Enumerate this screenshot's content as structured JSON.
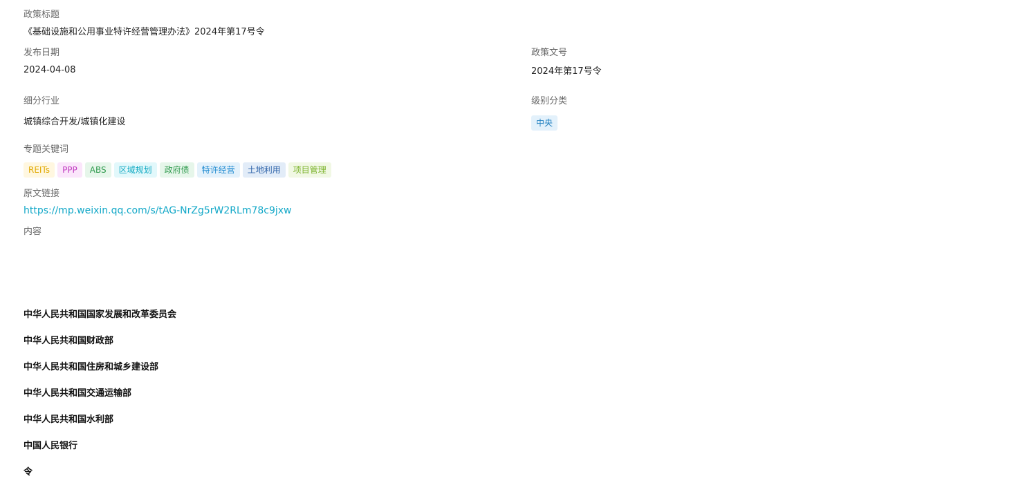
{
  "policy": {
    "title_label": "政策标题",
    "title_value": "《基础设施和公用事业特许经营管理办法》2024年第17号令",
    "date_label": "发布日期",
    "date_value": "2024-04-08",
    "docno_label": "政策文号",
    "docno_value": "2024年第17号令",
    "industry_label": "细分行业",
    "industry_value": "城镇综合开发/城镇化建设",
    "level_label": "级别分类",
    "level_value": "中央",
    "keywords_label": "专题关键词",
    "keywords": [
      {
        "text": "REITs",
        "bg": "#fff7e0",
        "fg": "#e0a800"
      },
      {
        "text": "PPP",
        "bg": "#fbe6fb",
        "fg": "#c03cc0"
      },
      {
        "text": "ABS",
        "bg": "#e6f6ea",
        "fg": "#2f9a4d"
      },
      {
        "text": "区域规划",
        "bg": "#e2f8fb",
        "fg": "#12aac3"
      },
      {
        "text": "政府债",
        "bg": "#e6f6ea",
        "fg": "#2f9a4d"
      },
      {
        "text": "特许经营",
        "bg": "#e3f1fb",
        "fg": "#1f8ad0"
      },
      {
        "text": "土地利用",
        "bg": "#e2ecf8",
        "fg": "#2d62a8"
      },
      {
        "text": "项目管理",
        "bg": "#f1f8e4",
        "fg": "#7ab22a"
      }
    ],
    "link_label": "原文链接",
    "link_value": "https://mp.weixin.qq.com/s/tAG-NrZg5rW2RLm78c9jxw",
    "content_label": "内容",
    "content_lines": [
      "中华人民共和国国家发展和改革委员会",
      "中华人民共和国财政部",
      "中华人民共和国住房和城乡建设部",
      "中华人民共和国交通运输部",
      "中华人民共和国水利部",
      "中国人民银行",
      "令"
    ]
  },
  "colors": {
    "level_tag_bg": "#e3f1fb",
    "level_tag_fg": "#1f7fc0",
    "link": "#13a8c8"
  }
}
